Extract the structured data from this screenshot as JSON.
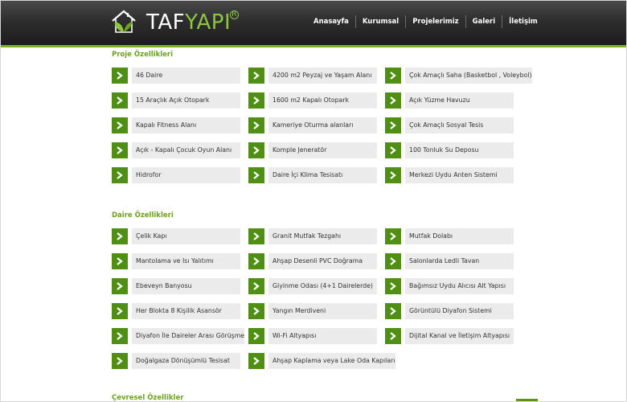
{
  "brand": {
    "part1": "TAF",
    "part2": "YAPI",
    "reg": "R"
  },
  "nav": [
    "Anasayfa",
    "Kurumsal",
    "Projelerimiz",
    "Galeri",
    "İletişim"
  ],
  "sections": [
    {
      "title": "Proje Özellikleri",
      "items": [
        "46 Daire",
        "4200 m2 Peyzaj ve Yaşam Alanı",
        "Çok Amaçlı Saha (Basketbol , Voleybol)",
        "15 Araçlık Açık Otopark",
        "1600 m2 Kapalı Otopark",
        "Açık Yüzme Havuzu",
        "Kapalı Fitness Alanı",
        "Kameriye Oturma alanları",
        "Çok Amaçlı Sosyal Tesis",
        "Açık - Kapalı Çocuk Oyun Alanı",
        "Komple Jeneratör",
        "100 Tonluk Su Deposu",
        "Hidrofor",
        "Daire İçi Klima Tesisatı",
        "Merkezi Uydu Anten Sistemi"
      ]
    },
    {
      "title": "Daire Özellikleri",
      "items": [
        "Çelik Kapı",
        "Granit Mutfak Tezgahı",
        "Mutfak Dolabı",
        "Mantolama ve Isı Yalıtımı",
        "Ahşap Desenli PVC Doğrama",
        "Salonlarda Ledli Tavan",
        "Ebeveyn Banyosu",
        "Giyinme Odası (4+1 Dairelerde)",
        "Bağımsız Uydu Alıcısı Alt Yapısı",
        "Her Blokta 8 Kişilik Asansör",
        "Yangın Merdiveni",
        "Görüntülü Diyafon Sistemi",
        "Diyafon İle Daireler Arası Görüşme",
        "Wi-Fi Altyapısı",
        "Dijital Kanal ve İletişim Altyapısı",
        "Doğalgaza Dönüşümlü Tesisat",
        "Ahşap Kaplama veya Lake Oda Kapıları"
      ]
    }
  ],
  "next_section_title": "Çevresel Özellikler",
  "colors": {
    "accent": "#7ab317",
    "arrow_bg": "#4f8f14",
    "title": "#6aa21c",
    "label_bg": "#ebebeb"
  }
}
